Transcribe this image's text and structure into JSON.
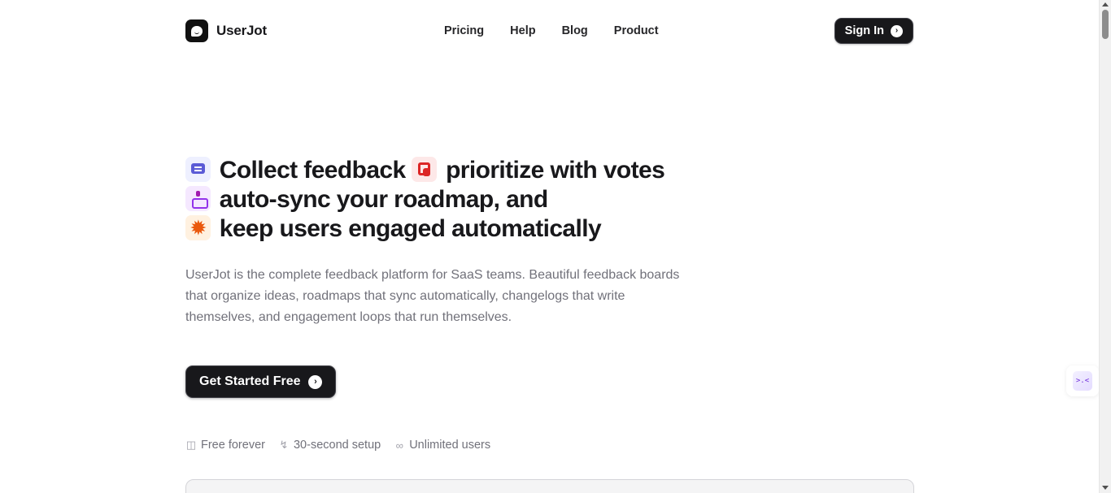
{
  "brand": {
    "name": "UserJot"
  },
  "nav": {
    "items": [
      {
        "label": "Pricing"
      },
      {
        "label": "Help"
      },
      {
        "label": "Blog"
      },
      {
        "label": "Product"
      }
    ],
    "sign_in": "Sign In",
    "arrow": "›"
  },
  "hero": {
    "headline": {
      "part1": "Collect feedback",
      "part2": "prioritize with votes",
      "part3": "auto-sync your roadmap, and",
      "part4": "keep users engaged automatically"
    },
    "icons": [
      "chat-icon",
      "vote-icon",
      "roadmap-sync-icon",
      "sun-engagement-icon"
    ],
    "subtext": "UserJot is the complete feedback platform for SaaS teams. Beautiful feedback boards that organize ideas, roadmaps that sync automatically, changelogs that write themselves, and engagement loops that run themselves.",
    "cta": "Get Started Free",
    "features": [
      {
        "icon": "gift-icon",
        "label": "Free forever"
      },
      {
        "icon": "bolt-icon",
        "label": "30-second setup"
      },
      {
        "icon": "infinity-icon",
        "label": "Unlimited users"
      }
    ]
  },
  "widget": {
    "label": ">.<",
    "icon": "feedback-widget-icon"
  },
  "colors": {
    "text": "#18181b",
    "muted": "#71717a",
    "button_bg": "#18181b",
    "chat_icon": "#5b5bd6",
    "vote_icon": "#dc2626",
    "sync_icon": "#9333ea",
    "sun_icon": "#ea580c"
  }
}
